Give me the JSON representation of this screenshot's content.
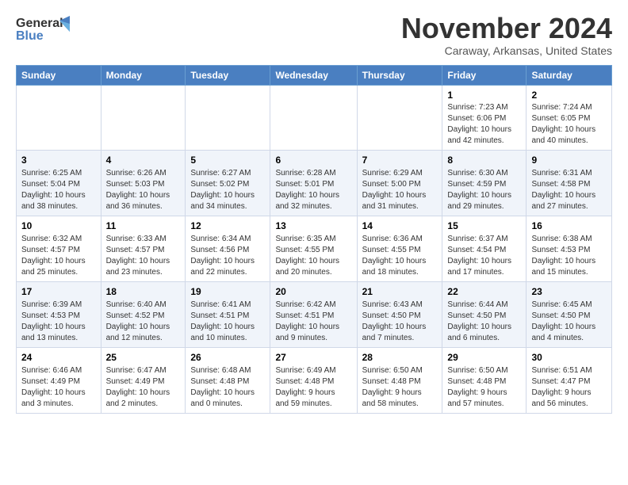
{
  "header": {
    "logo_line1": "General",
    "logo_line2": "Blue",
    "month": "November 2024",
    "location": "Caraway, Arkansas, United States"
  },
  "weekdays": [
    "Sunday",
    "Monday",
    "Tuesday",
    "Wednesday",
    "Thursday",
    "Friday",
    "Saturday"
  ],
  "weeks": [
    [
      {
        "day": "",
        "info": ""
      },
      {
        "day": "",
        "info": ""
      },
      {
        "day": "",
        "info": ""
      },
      {
        "day": "",
        "info": ""
      },
      {
        "day": "",
        "info": ""
      },
      {
        "day": "1",
        "info": "Sunrise: 7:23 AM\nSunset: 6:06 PM\nDaylight: 10 hours\nand 42 minutes."
      },
      {
        "day": "2",
        "info": "Sunrise: 7:24 AM\nSunset: 6:05 PM\nDaylight: 10 hours\nand 40 minutes."
      }
    ],
    [
      {
        "day": "3",
        "info": "Sunrise: 6:25 AM\nSunset: 5:04 PM\nDaylight: 10 hours\nand 38 minutes."
      },
      {
        "day": "4",
        "info": "Sunrise: 6:26 AM\nSunset: 5:03 PM\nDaylight: 10 hours\nand 36 minutes."
      },
      {
        "day": "5",
        "info": "Sunrise: 6:27 AM\nSunset: 5:02 PM\nDaylight: 10 hours\nand 34 minutes."
      },
      {
        "day": "6",
        "info": "Sunrise: 6:28 AM\nSunset: 5:01 PM\nDaylight: 10 hours\nand 32 minutes."
      },
      {
        "day": "7",
        "info": "Sunrise: 6:29 AM\nSunset: 5:00 PM\nDaylight: 10 hours\nand 31 minutes."
      },
      {
        "day": "8",
        "info": "Sunrise: 6:30 AM\nSunset: 4:59 PM\nDaylight: 10 hours\nand 29 minutes."
      },
      {
        "day": "9",
        "info": "Sunrise: 6:31 AM\nSunset: 4:58 PM\nDaylight: 10 hours\nand 27 minutes."
      }
    ],
    [
      {
        "day": "10",
        "info": "Sunrise: 6:32 AM\nSunset: 4:57 PM\nDaylight: 10 hours\nand 25 minutes."
      },
      {
        "day": "11",
        "info": "Sunrise: 6:33 AM\nSunset: 4:57 PM\nDaylight: 10 hours\nand 23 minutes."
      },
      {
        "day": "12",
        "info": "Sunrise: 6:34 AM\nSunset: 4:56 PM\nDaylight: 10 hours\nand 22 minutes."
      },
      {
        "day": "13",
        "info": "Sunrise: 6:35 AM\nSunset: 4:55 PM\nDaylight: 10 hours\nand 20 minutes."
      },
      {
        "day": "14",
        "info": "Sunrise: 6:36 AM\nSunset: 4:55 PM\nDaylight: 10 hours\nand 18 minutes."
      },
      {
        "day": "15",
        "info": "Sunrise: 6:37 AM\nSunset: 4:54 PM\nDaylight: 10 hours\nand 17 minutes."
      },
      {
        "day": "16",
        "info": "Sunrise: 6:38 AM\nSunset: 4:53 PM\nDaylight: 10 hours\nand 15 minutes."
      }
    ],
    [
      {
        "day": "17",
        "info": "Sunrise: 6:39 AM\nSunset: 4:53 PM\nDaylight: 10 hours\nand 13 minutes."
      },
      {
        "day": "18",
        "info": "Sunrise: 6:40 AM\nSunset: 4:52 PM\nDaylight: 10 hours\nand 12 minutes."
      },
      {
        "day": "19",
        "info": "Sunrise: 6:41 AM\nSunset: 4:51 PM\nDaylight: 10 hours\nand 10 minutes."
      },
      {
        "day": "20",
        "info": "Sunrise: 6:42 AM\nSunset: 4:51 PM\nDaylight: 10 hours\nand 9 minutes."
      },
      {
        "day": "21",
        "info": "Sunrise: 6:43 AM\nSunset: 4:50 PM\nDaylight: 10 hours\nand 7 minutes."
      },
      {
        "day": "22",
        "info": "Sunrise: 6:44 AM\nSunset: 4:50 PM\nDaylight: 10 hours\nand 6 minutes."
      },
      {
        "day": "23",
        "info": "Sunrise: 6:45 AM\nSunset: 4:50 PM\nDaylight: 10 hours\nand 4 minutes."
      }
    ],
    [
      {
        "day": "24",
        "info": "Sunrise: 6:46 AM\nSunset: 4:49 PM\nDaylight: 10 hours\nand 3 minutes."
      },
      {
        "day": "25",
        "info": "Sunrise: 6:47 AM\nSunset: 4:49 PM\nDaylight: 10 hours\nand 2 minutes."
      },
      {
        "day": "26",
        "info": "Sunrise: 6:48 AM\nSunset: 4:48 PM\nDaylight: 10 hours\nand 0 minutes."
      },
      {
        "day": "27",
        "info": "Sunrise: 6:49 AM\nSunset: 4:48 PM\nDaylight: 9 hours\nand 59 minutes."
      },
      {
        "day": "28",
        "info": "Sunrise: 6:50 AM\nSunset: 4:48 PM\nDaylight: 9 hours\nand 58 minutes."
      },
      {
        "day": "29",
        "info": "Sunrise: 6:50 AM\nSunset: 4:48 PM\nDaylight: 9 hours\nand 57 minutes."
      },
      {
        "day": "30",
        "info": "Sunrise: 6:51 AM\nSunset: 4:47 PM\nDaylight: 9 hours\nand 56 minutes."
      }
    ]
  ]
}
